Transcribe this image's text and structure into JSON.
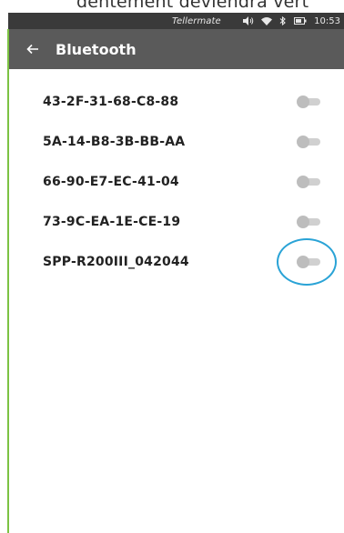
{
  "top_caption": "dentement deviendra vert",
  "status_bar": {
    "brand": "Tellermate",
    "time": "10:53",
    "icons": [
      "volume-icon",
      "wifi-icon",
      "bluetooth-icon",
      "battery-icon"
    ]
  },
  "app_bar": {
    "title": "Bluetooth",
    "back_icon": "back-arrow-icon"
  },
  "devices": [
    {
      "name": "43-2F-31-68-C8-88",
      "enabled": false
    },
    {
      "name": "5A-14-B8-3B-BB-AA",
      "enabled": false
    },
    {
      "name": "66-90-E7-EC-41-04",
      "enabled": false
    },
    {
      "name": "73-9C-EA-1E-CE-19",
      "enabled": false
    },
    {
      "name": "SPP-R200III_042044",
      "enabled": false,
      "highlighted": true
    }
  ],
  "colors": {
    "status_bar": "#3a3a3a",
    "app_bar": "#5a5a5a",
    "accent_line": "#7cc242",
    "highlight": "#2aa3d6",
    "toggle_off": "#bdbdbd"
  }
}
